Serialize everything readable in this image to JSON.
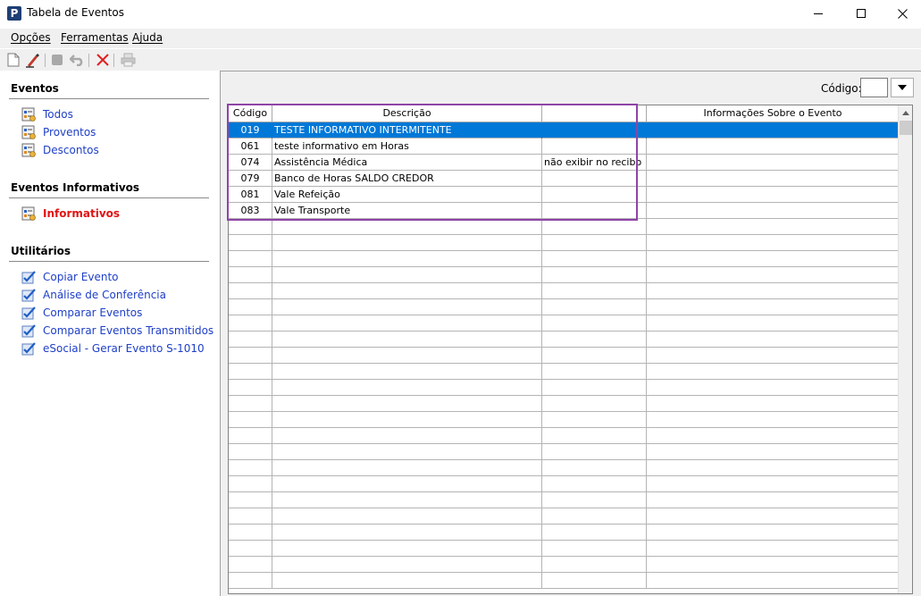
{
  "window": {
    "title": "Tabela de Eventos",
    "app_icon_letter": "P"
  },
  "menu": [
    "Opções",
    "Ferramentas",
    "Ajuda"
  ],
  "toolbar": {
    "icons": [
      "new-document-icon",
      "edit-icon",
      "stop-icon",
      "undo-icon",
      "delete-icon",
      "print-icon"
    ]
  },
  "sidebar": {
    "sections": [
      {
        "title": "Eventos",
        "items": [
          {
            "label": "Todos",
            "icon": "event-list-icon",
            "active": false
          },
          {
            "label": "Proventos",
            "icon": "event-list-icon",
            "active": false
          },
          {
            "label": "Descontos",
            "icon": "event-list-icon",
            "active": false
          }
        ]
      },
      {
        "title": "Eventos Informativos",
        "items": [
          {
            "label": "Informativos",
            "icon": "event-list-icon",
            "active": true
          }
        ]
      },
      {
        "title": "Utilitários",
        "items": [
          {
            "label": "Copiar Evento",
            "icon": "checkmark-icon",
            "active": false
          },
          {
            "label": "Análise de Conferência",
            "icon": "checkmark-icon",
            "active": false
          },
          {
            "label": "Comparar Eventos",
            "icon": "checkmark-icon",
            "active": false
          },
          {
            "label": "Comparar Eventos Transmitidos",
            "icon": "checkmark-icon",
            "active": false
          },
          {
            "label": "eSocial - Gerar Evento S-1010",
            "icon": "checkmark-icon",
            "active": false
          }
        ]
      }
    ]
  },
  "filter": {
    "codigo_label": "Código:",
    "codigo_value": ""
  },
  "grid": {
    "columns": [
      "Código",
      "Descrição",
      "",
      "Informações Sobre o Evento"
    ],
    "rows": [
      {
        "codigo": "019",
        "descricao": "TESTE INFORMATIVO INTERMITENTE",
        "extra": "",
        "info": "",
        "selected": true
      },
      {
        "codigo": "061",
        "descricao": "teste informativo em Horas",
        "extra": "",
        "info": "",
        "selected": false
      },
      {
        "codigo": "074",
        "descricao": "Assistência Médica",
        "extra": "não exibir no recibo",
        "info": "",
        "selected": false
      },
      {
        "codigo": "079",
        "descricao": "Banco de Horas SALDO CREDOR",
        "extra": "",
        "info": "",
        "selected": false
      },
      {
        "codigo": "081",
        "descricao": "Vale Refeição",
        "extra": "",
        "info": "",
        "selected": false
      },
      {
        "codigo": "083",
        "descricao": "Vale Transporte",
        "extra": "",
        "info": "",
        "selected": false
      }
    ]
  },
  "colors": {
    "selection": "#0078d7",
    "link": "#1e3fc7",
    "active_link": "#e01414",
    "highlight_box": "#8e44a8"
  }
}
